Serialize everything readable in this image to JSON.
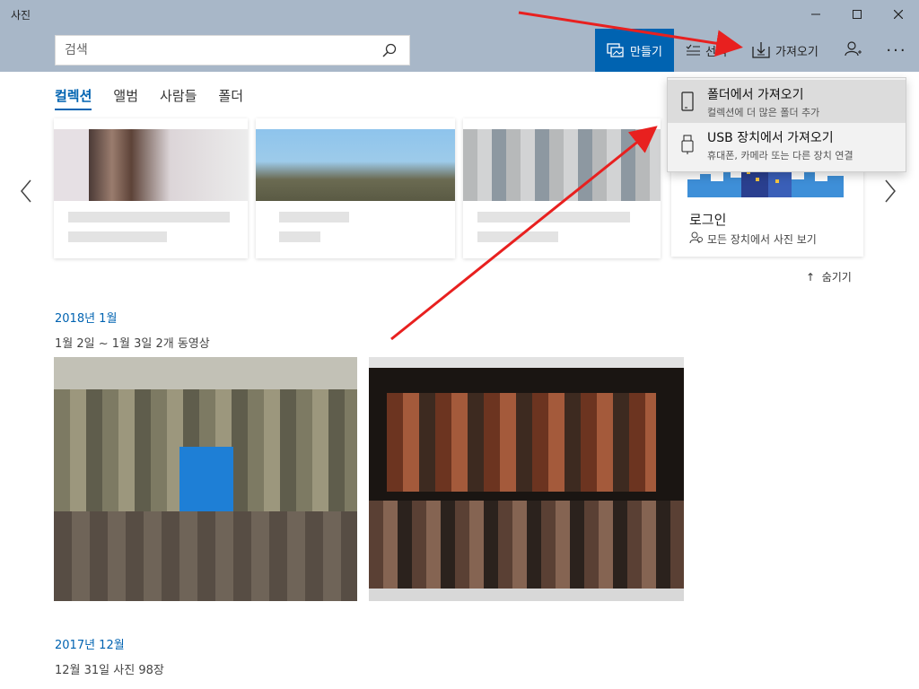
{
  "window": {
    "title": "사진"
  },
  "search": {
    "placeholder": "검색"
  },
  "toolbar": {
    "create_label": "만들기",
    "select_label": "선택",
    "import_label": "가져오기"
  },
  "tabs": [
    {
      "label": "컬렉션",
      "active": true
    },
    {
      "label": "앨범"
    },
    {
      "label": "사람들"
    },
    {
      "label": "폴더"
    }
  ],
  "import_menu": {
    "items": [
      {
        "label": "폴더에서 가져오기",
        "sub": "컬렉션에 더 많은 폴더 추가",
        "icon": "folder-icon"
      },
      {
        "label": "USB 장치에서 가져오기",
        "sub": "휴대폰, 카메라 또는 다른 장치 연결",
        "icon": "usb-icon"
      }
    ]
  },
  "login_card": {
    "title": "로그인",
    "subtitle": "모든 장치에서 사진 보기"
  },
  "hide_label": "숨기기",
  "sections": [
    {
      "heading": "2018년 1월",
      "sub": "1월 2일 ~ 1월 3일   2개 동영상"
    },
    {
      "heading": "2017년 12월",
      "sub": "12월 31일   사진 98장"
    }
  ],
  "colors": {
    "accent": "#0063b1",
    "toolbar_bg": "#a8b7c8",
    "annotation": "#e8201f"
  }
}
